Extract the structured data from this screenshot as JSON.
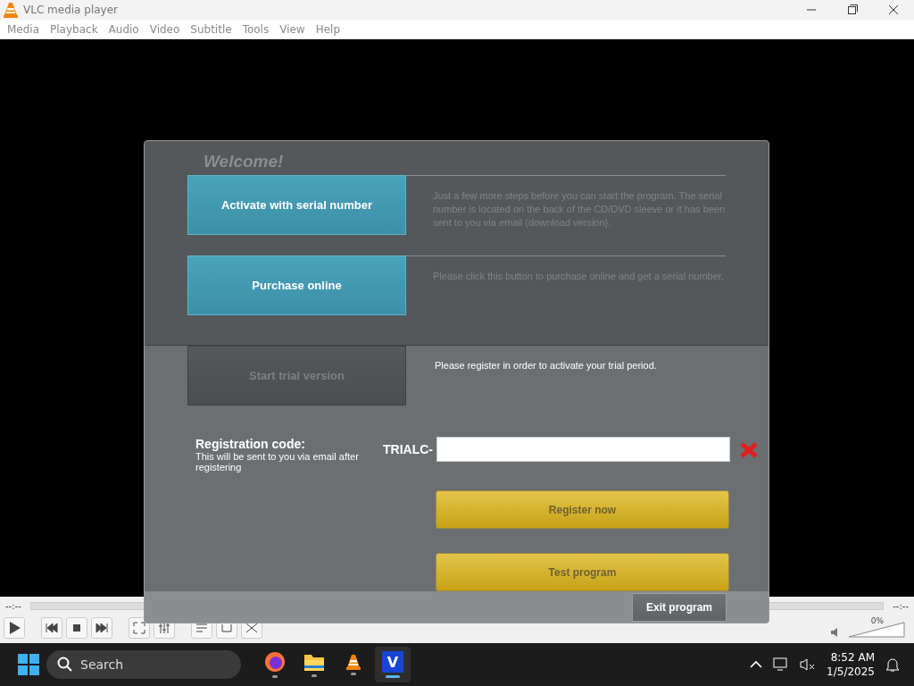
{
  "window": {
    "title": "VLC media player"
  },
  "menu": [
    "Media",
    "Playback",
    "Audio",
    "Video",
    "Subtitle",
    "Tools",
    "View",
    "Help"
  ],
  "player": {
    "elapsed": "--:--",
    "remaining": "--:--",
    "volume": {
      "level": 0,
      "reading": "0%"
    }
  },
  "dialog": {
    "heading": "Welcome!",
    "options": [
      {
        "label": "Activate with serial number",
        "description": "Just a few more steps before you can start the program. The serial number is located on the back of the CD/DVD sleeve or it has been sent to you via email (download version).",
        "selected": false
      },
      {
        "label": "Purchase online",
        "description": "Please click this button to purchase online and get a serial number.",
        "selected": false
      },
      {
        "label": "Start trial version",
        "description": "Please register in order to activate your trial period.",
        "selected": true
      }
    ],
    "registration": {
      "label": "Registration code:",
      "hint": "This will be sent to you via email after registering",
      "prefix": "TRIALC-"
    },
    "actions": [
      "Register now",
      "Test program"
    ],
    "exit_button": "Exit program"
  },
  "taskbar": {
    "search": {
      "placeholder": "Search"
    },
    "apps": [
      {
        "kind": "browser",
        "selected": false
      },
      {
        "kind": "folder",
        "selected": false
      },
      {
        "kind": "cone",
        "selected": false
      },
      {
        "kind": "letter",
        "label": "V",
        "selected": true
      }
    ],
    "time": "8:52 AM",
    "date": "1/5/2025"
  }
}
